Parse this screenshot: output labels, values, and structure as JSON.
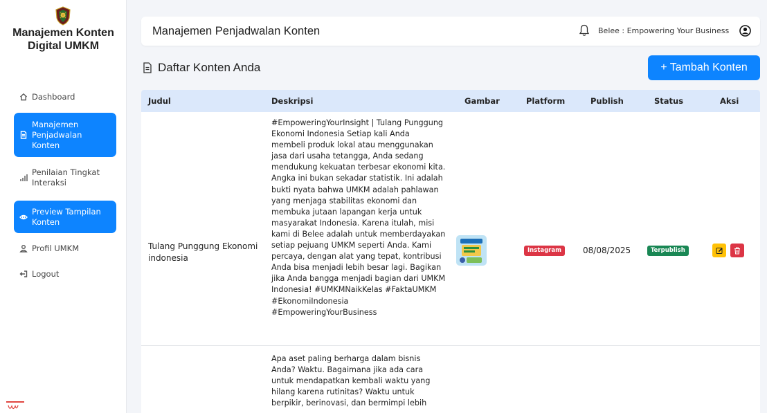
{
  "sidebar": {
    "brand": "Manajemen Konten Digital UMKM",
    "items": [
      {
        "label": "Dashboard",
        "icon": "home-icon",
        "active": false
      },
      {
        "label": "Manajemen Penjadwalan Konten",
        "icon": "document-icon",
        "active": true
      },
      {
        "label": "Penilaian Tingkat Interaksi",
        "icon": "bar-chart-icon",
        "active": false
      },
      {
        "label": "Preview Tampilan Konten",
        "icon": "eye-icon",
        "active": true
      },
      {
        "label": "Profil UMKM",
        "icon": "user-icon",
        "active": false
      },
      {
        "label": "Logout",
        "icon": "logout-icon",
        "active": false
      }
    ]
  },
  "header": {
    "title": "Manajemen Penjadwalan Konten",
    "business": "Belee : Empowering Your Business"
  },
  "section": {
    "title": "Daftar Konten Anda",
    "add_label": "+ Tambah Konten"
  },
  "table": {
    "columns": [
      "Judul",
      "Deskripsi",
      "Gambar",
      "Platform",
      "Publish",
      "Status",
      "Aksi"
    ],
    "rows": [
      {
        "judul": "Tulang Punggung Ekonomi indonesia",
        "deskripsi": "#EmpoweringYourInsight | Tulang Punggung Ekonomi Indonesia Setiap kali Anda membeli produk lokal atau menggunakan jasa dari usaha tetangga, Anda sedang mendukung kekuatan terbesar ekonomi kita. Angka ini bukan sekadar statistik. Ini adalah bukti nyata bahwa UMKM adalah pahlawan yang menjaga stabilitas ekonomi dan membuka jutaan lapangan kerja untuk masyarakat Indonesia. Karena itulah, misi kami di Belee adalah untuk memberdayakan setiap pejuang UMKM seperti Anda. Kami percaya, dengan alat yang tepat, kontribusi Anda bisa menjadi lebih besar lagi. Bagikan jika Anda bangga menjadi bagian dari UMKM Indonesia! #UMKMNaikKelas #FaktaUMKM #EkonomiIndonesia #EmpoweringYourBusiness",
        "platform": "Instagram",
        "publish": "08/08/2025",
        "status": "Terpublish"
      },
      {
        "judul": "",
        "deskripsi": "Apa aset paling berharga dalam bisnis Anda? Waktu. Bagaimana jika ada cara untuk mendapatkan kembali waktu yang hilang karena rutinitas? Waktu untuk berpikir, berinovasi, dan bermimpi lebih"
      }
    ]
  },
  "colors": {
    "primary": "#0d84ff",
    "table_header": "#dbe8fb",
    "instagram_badge": "#dc3545",
    "published_badge": "#198754",
    "edit_button": "#ffc107",
    "delete_button": "#dc3545"
  }
}
